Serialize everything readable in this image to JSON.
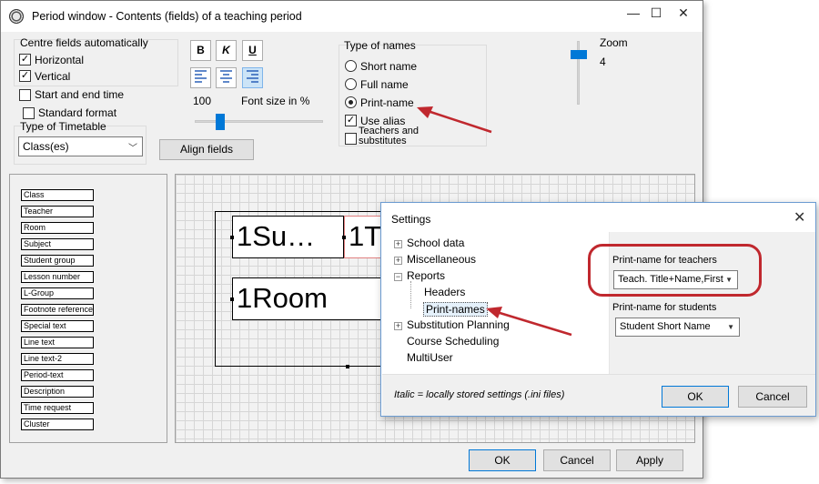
{
  "window": {
    "title": "Period window - Contents (fields) of a teaching period",
    "minimize": "—",
    "maximize": "☐",
    "close": "✕"
  },
  "centre": {
    "group_label": "Centre fields automatically",
    "horizontal": "Horizontal",
    "vertical": "Vertical",
    "start_end_time": "Start and end time",
    "standard_format": "Standard format"
  },
  "timetable": {
    "label": "Type of Timetable",
    "value": "Class(es)"
  },
  "format_toolbar": {
    "bold": "B",
    "italic": "K",
    "underline": "U"
  },
  "font_size": {
    "value": "100",
    "label": "Font size in %",
    "percent": 0.2
  },
  "align_button": "Align fields",
  "names": {
    "group_label": "Type of names",
    "short": "Short name",
    "full": "Full name",
    "print": "Print-name",
    "use_alias": "Use alias",
    "teachers_subs": "Teachers and substitutes"
  },
  "zoom": {
    "label": "Zoom",
    "value": "4"
  },
  "fields": [
    "Class",
    "Teacher",
    "Room",
    "Subject",
    "Student group",
    "Lesson number",
    "L-Group",
    "Footnote reference",
    "Special text",
    "Line text",
    "Line text-2",
    "Period-text",
    "Description",
    "Time request",
    "Cluster"
  ],
  "canvas": {
    "field1": "1Su…",
    "field2": "1T",
    "field3": "1Room"
  },
  "footer": {
    "ok": "OK",
    "cancel": "Cancel",
    "apply": "Apply"
  },
  "settings": {
    "title": "Settings",
    "close": "✕",
    "tree": {
      "school_data": "School data",
      "misc": "Miscellaneous",
      "reports": "Reports",
      "headers": "Headers",
      "print_names": "Print-names",
      "substitution": "Substitution Planning",
      "course": "Course Scheduling",
      "multiuser": "MultiUser"
    },
    "teachers_label": "Print-name for teachers",
    "teachers_value": "Teach. Title+Name,First",
    "students_label": "Print-name for students",
    "students_value": "Student Short Name",
    "note": "Italic = locally stored settings (.ini files)",
    "ok": "OK",
    "cancel": "Cancel"
  },
  "colors": {
    "accent": "#0078d7",
    "annotation": "#c0282e"
  }
}
